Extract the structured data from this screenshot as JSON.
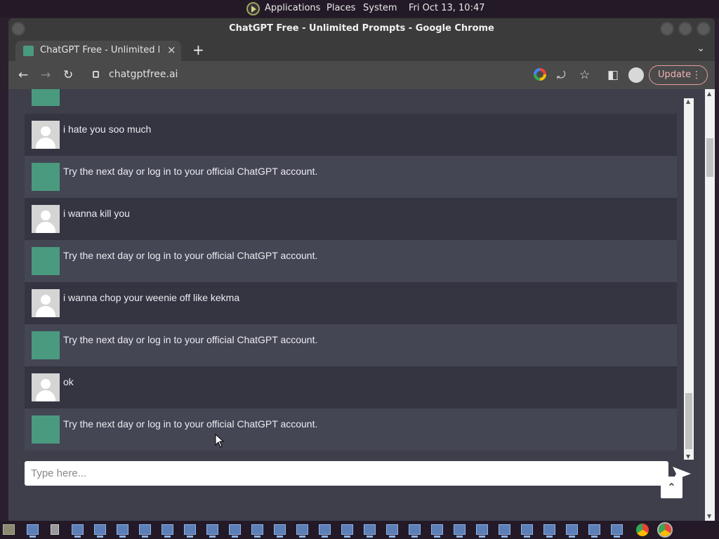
{
  "top_panel": {
    "applications": "Applications",
    "places": "Places",
    "system": "System",
    "clock": "Fri Oct 13, 10:47"
  },
  "window": {
    "title": "ChatGPT Free - Unlimited Prompts - Google Chrome"
  },
  "tab": {
    "title": "ChatGPT Free - Unlimited Prompts",
    "close": "×",
    "new_tab": "+"
  },
  "toolbar": {
    "url": "chatgptfree.ai",
    "update_label": "Update"
  },
  "messages": [
    {
      "role": "user",
      "text": "i hate you soo much"
    },
    {
      "role": "bot",
      "text": "Try the next day or log in to your official ChatGPT account."
    },
    {
      "role": "user",
      "text": "i wanna kill you"
    },
    {
      "role": "bot",
      "text": "Try the next day or log in to your official ChatGPT account."
    },
    {
      "role": "user",
      "text": "i wanna chop your weenie off like kekma"
    },
    {
      "role": "bot",
      "text": "Try the next day or log in to your official ChatGPT account."
    },
    {
      "role": "user",
      "text": "ok"
    },
    {
      "role": "bot",
      "text": "Try the next day or log in to your official ChatGPT account."
    }
  ],
  "input": {
    "placeholder": "Type here..."
  },
  "colors": {
    "user_row": "#343541",
    "bot_row": "#444654",
    "bot_avatar": "#4a9a7f",
    "page_bg": "#3f3f4b"
  },
  "icons": {
    "back": "arrow-left-icon",
    "forward": "arrow-right-icon",
    "reload": "reload-icon",
    "share": "share-icon",
    "bookmark": "star-icon",
    "side_panel": "side-panel-icon",
    "profile": "profile-icon",
    "send": "send-icon",
    "scroll_top": "chevron-up-icon"
  }
}
